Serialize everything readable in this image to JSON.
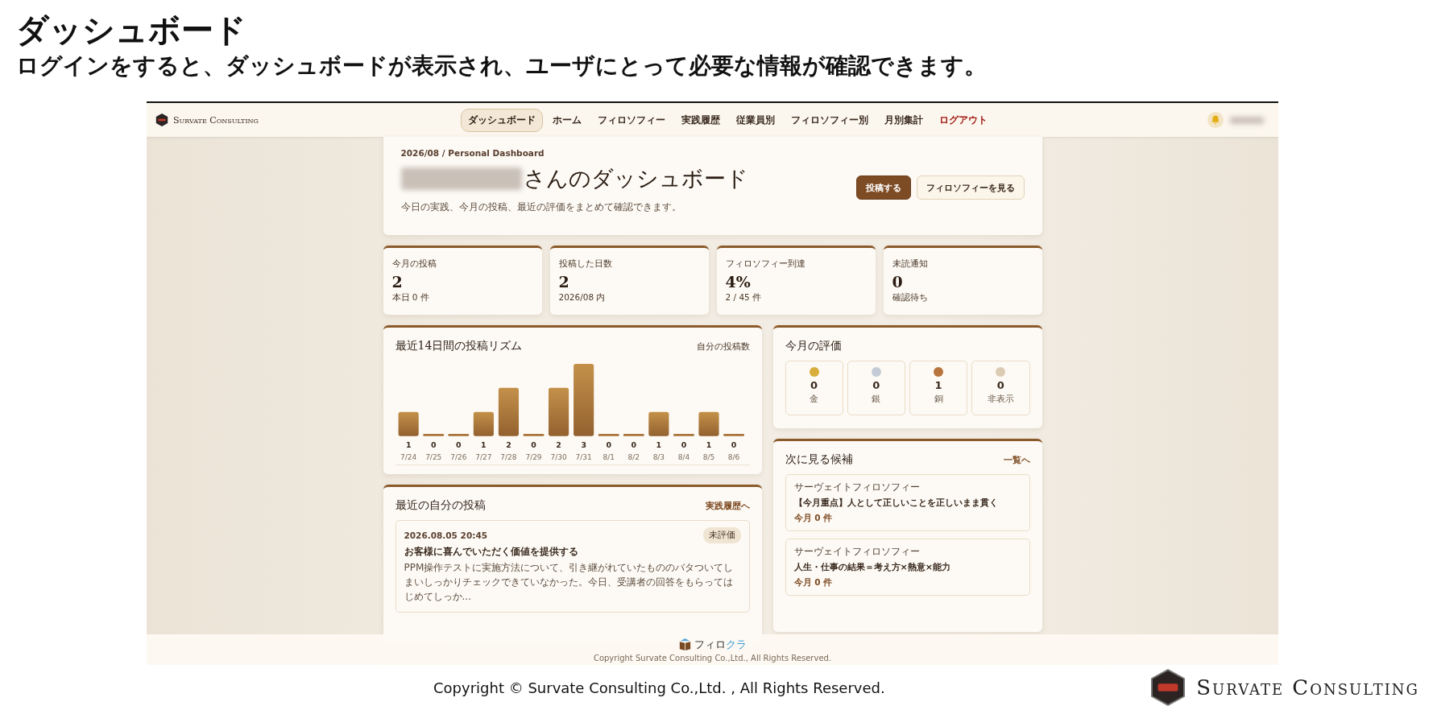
{
  "slide": {
    "title": "ダッシュボード",
    "subtitle": "ログインをすると、ダッシュボードが表示され、ユーザにとって必要な情報が確認できます。",
    "copyright": "Copyright © Survate Consulting Co.,Ltd. , All Rights Reserved.",
    "logo_text": "Survate Consulting"
  },
  "app": {
    "brand": "Survate Consulting",
    "nav": [
      {
        "label": "ダッシュボード",
        "selected": true,
        "kind": "link"
      },
      {
        "label": "ホーム",
        "selected": false,
        "kind": "link"
      },
      {
        "label": "フィロソフィー",
        "selected": false,
        "kind": "link"
      },
      {
        "label": "実践履歴",
        "selected": false,
        "kind": "link"
      },
      {
        "label": "従業員別",
        "selected": false,
        "kind": "link"
      },
      {
        "label": "フィロソフィー別",
        "selected": false,
        "kind": "link"
      },
      {
        "label": "月別集計",
        "selected": false,
        "kind": "link"
      },
      {
        "label": "ログアウト",
        "selected": false,
        "kind": "logout"
      }
    ],
    "header": {
      "eyebrow": "2026/08 / Personal Dashboard",
      "title": "さんのダッシュボード",
      "description": "今日の実践、今月の投稿、最近の評価をまとめて確認できます。",
      "buttons": [
        {
          "label": "投稿する",
          "kind": "primary"
        },
        {
          "label": "フィロソフィーを見る",
          "kind": "secondary"
        }
      ]
    },
    "stats": [
      {
        "label": "今月の投稿",
        "value": "2",
        "note": "本日 0 件"
      },
      {
        "label": "投稿した日数",
        "value": "2",
        "note": "2026/08 内"
      },
      {
        "label": "フィロソフィー到達",
        "value": "4%",
        "note": "2 / 45 件"
      },
      {
        "label": "未読通知",
        "value": "0",
        "note": "確認待ち"
      }
    ],
    "chart_card": {
      "title": "最近14日間の投稿リズム",
      "legend": "自分の投稿数",
      "chart_data": {
        "type": "bar",
        "categories": [
          "7/24",
          "7/25",
          "7/26",
          "7/27",
          "7/28",
          "7/29",
          "7/30",
          "7/31",
          "8/1",
          "8/2",
          "8/3",
          "8/4",
          "8/5",
          "8/6"
        ],
        "values": [
          1,
          0,
          0,
          1,
          2,
          0,
          2,
          3,
          0,
          0,
          1,
          0,
          1,
          0
        ],
        "data_labels": true
      }
    },
    "ratings": {
      "title": "今月の評価",
      "items": [
        {
          "color": "#d9ad3c",
          "count": "0",
          "label": "金"
        },
        {
          "color": "#c3ccd6",
          "count": "0",
          "label": "銀"
        },
        {
          "color": "#b8743d",
          "count": "1",
          "label": "銅"
        },
        {
          "color": "#dccbb3",
          "count": "0",
          "label": "非表示"
        }
      ]
    },
    "candidates": {
      "title": "次に見る候補",
      "link": "一覧へ",
      "items": [
        {
          "category": "サーヴェイトフィロソフィー",
          "title": "【今月重点】人として正しいことを正しいまま貫く",
          "count": "今月 0 件"
        },
        {
          "category": "サーヴェイトフィロソフィー",
          "title": "人生・仕事の結果＝考え方×熱意×能力",
          "count": "今月 0 件"
        }
      ]
    },
    "recent_posts": {
      "title": "最近の自分の投稿",
      "link": "実践履歴へ",
      "items": [
        {
          "datetime": "2026.08.05 20:45",
          "status": "未評価",
          "title": "お客様に喜んでいただく価値を提供する",
          "excerpt": "PPM操作テストに実施方法について、引き継がれていたもののバタついてしまいしっかりチェックできていなかった。今日、受講者の回答をもらってはじめてしっか..."
        }
      ]
    },
    "footer": {
      "app_name": [
        "フィロ",
        "クラ"
      ],
      "copyright": "Copyright Survate Consulting Co.,Ltd., All Rights Reserved."
    }
  }
}
